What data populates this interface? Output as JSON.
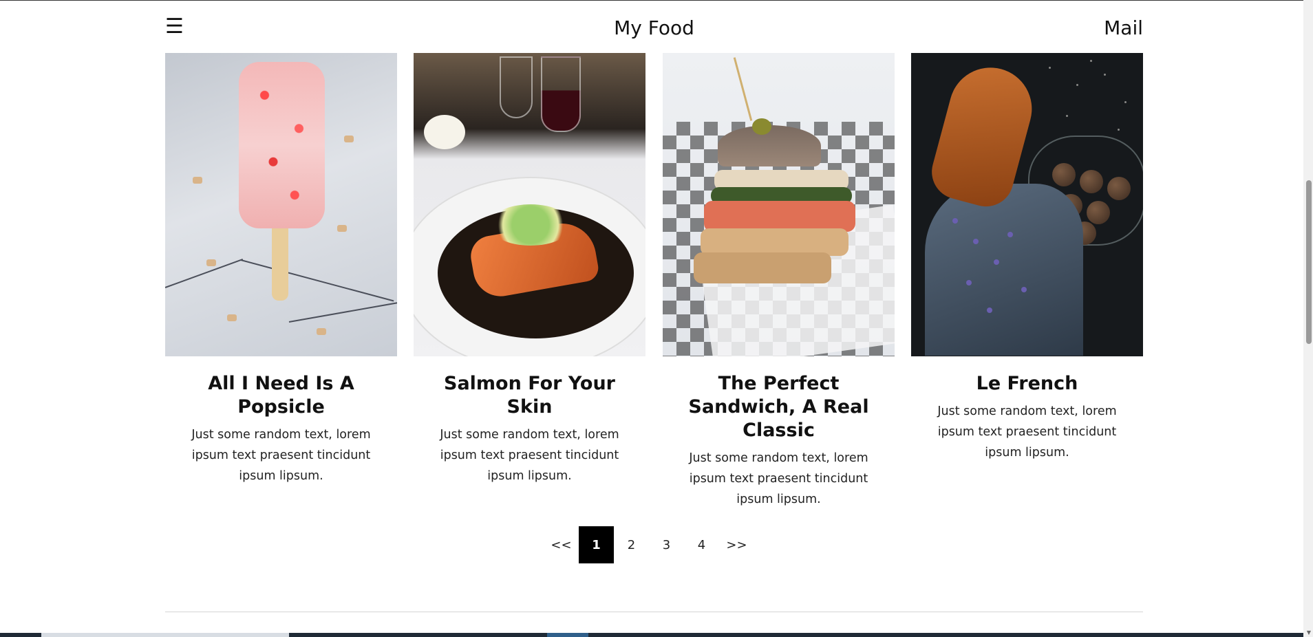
{
  "header": {
    "menu_icon": "☰",
    "title": "My Food",
    "mail_label": "Mail"
  },
  "cards": [
    {
      "title": "All I Need Is A Popsicle",
      "description": "Just some random text, lorem ipsum text praesent tincidunt ipsum lipsum."
    },
    {
      "title": "Salmon For Your Skin",
      "description": "Just some random text, lorem ipsum text praesent tincidunt ipsum lipsum."
    },
    {
      "title": "The Perfect Sandwich, A Real Classic",
      "description": "Just some random text, lorem ipsum text praesent tincidunt ipsum lipsum."
    },
    {
      "title": "Le French",
      "description": "Just some random text, lorem ipsum text praesent tincidunt ipsum lipsum."
    }
  ],
  "pagination": {
    "prev_label": "<<",
    "pages": [
      "1",
      "2",
      "3",
      "4"
    ],
    "active_page": "1",
    "next_label": ">>"
  },
  "colors": {
    "active_page_bg": "#000000",
    "text": "#111111"
  }
}
